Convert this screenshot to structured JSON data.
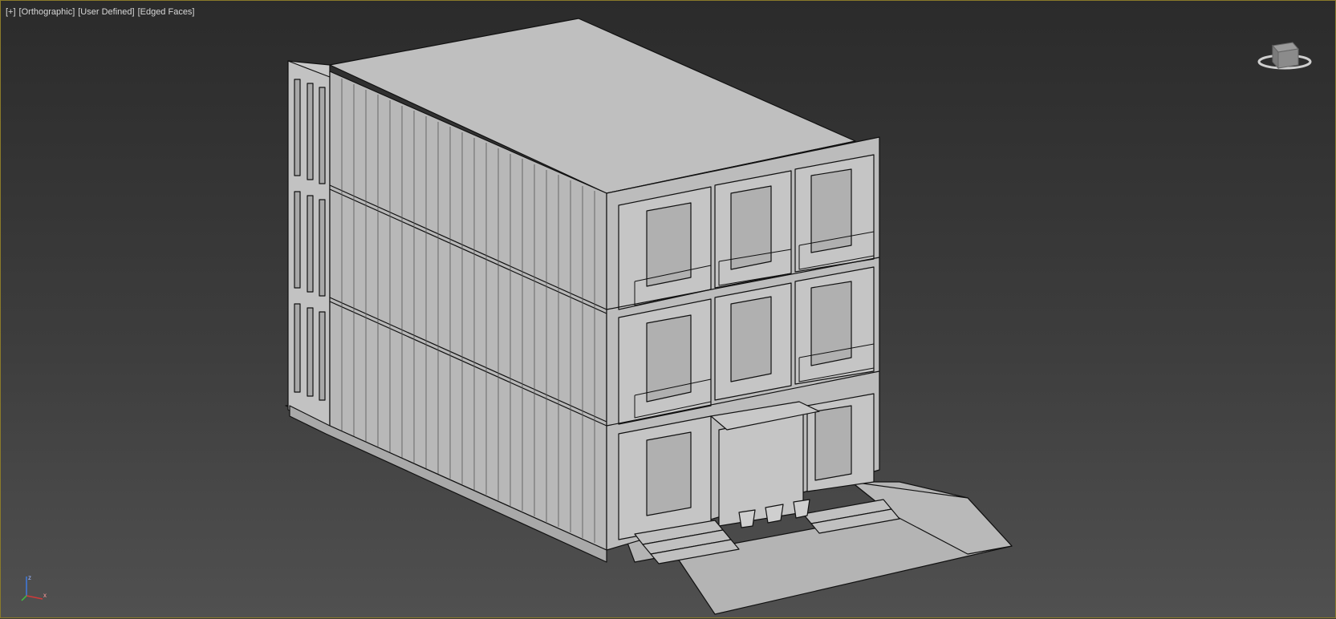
{
  "viewport": {
    "menu": {
      "plus": "[+]",
      "projection": "[Orthographic]",
      "shading": "[User Defined]",
      "edges": "[Edged Faces]"
    },
    "viewcube": {
      "icon": "viewcube-icon"
    },
    "axis_tripod": {
      "icon": "axis-tripod-icon",
      "x_label": "x",
      "z_label": "z"
    }
  },
  "scene": {
    "description_colors": {
      "background_top": "#2b2b2b",
      "background_bottom": "#505050",
      "model_fill": "#bdbdbd",
      "model_edge": "#111111",
      "viewport_border": "#8a7a2a"
    },
    "model": "container-house-wireframe",
    "floors": 3,
    "front_units": 3,
    "planters": 3
  }
}
